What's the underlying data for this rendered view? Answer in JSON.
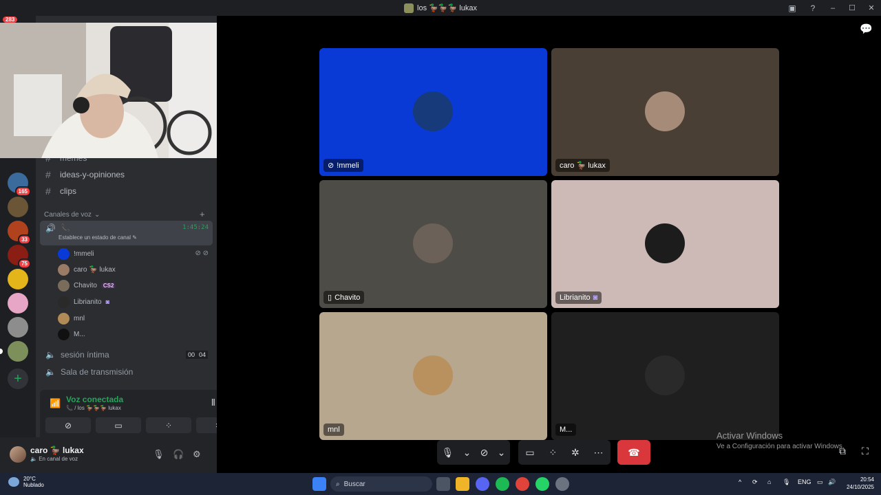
{
  "window": {
    "title": "los 🦆🦆🦆 lukax",
    "icons": [
      "inbox-icon",
      "help-icon",
      "minimize-icon",
      "maximize-icon",
      "close-icon"
    ]
  },
  "server_rail": {
    "top_badge": "283",
    "badges": [
      "165",
      "33",
      "75"
    ]
  },
  "channels": {
    "text": [
      "memes",
      "ideas-y-opiniones",
      "clips"
    ],
    "voice_category": "Canales de voz",
    "active_voice": {
      "time": "1:45:24",
      "status_placeholder": "Establece un estado de canal"
    },
    "members": [
      {
        "name": "!mmeli",
        "tag": ""
      },
      {
        "name": "caro 🦆 lukax",
        "tag": ""
      },
      {
        "name": "Chavito",
        "tag": "CS2"
      },
      {
        "name": "Librianito",
        "tag": ""
      },
      {
        "name": "mnl",
        "tag": ""
      },
      {
        "name": "M...",
        "tag": ""
      }
    ],
    "other_voice": [
      {
        "name": "sesión íntima",
        "count_a": "00",
        "count_b": "04"
      },
      {
        "name": "Sala de transmisión"
      }
    ]
  },
  "voice_panel": {
    "title": "Voz conectada",
    "subtitle": "/ los 🦆🦆🦆 lukax"
  },
  "user_panel": {
    "name": "caro 🦆 lukax",
    "status": "En canal de voz"
  },
  "tiles": [
    {
      "name": "!mmeli",
      "bg": "#0a3ad6"
    },
    {
      "name": "caro 🦆 lukax",
      "bg": "#4a3f35"
    },
    {
      "name": "Chavito",
      "bg": "#4e4c47"
    },
    {
      "name": "Librianito",
      "bg": "#cdb9b5"
    },
    {
      "name": "mnl",
      "bg": "#b7a78f"
    },
    {
      "name": "M...",
      "bg": "#1f1f1f"
    }
  ],
  "watermark": {
    "title": "Activar Windows",
    "subtitle": "Ve a Configuración para activar Windows."
  },
  "taskbar": {
    "weather_temp": "20°C",
    "weather_desc": "Nublado",
    "search_placeholder": "Buscar",
    "lang": "ENG",
    "time": "20:54",
    "date": "24/10/2025"
  },
  "colors": {
    "accent_green": "#23a55a",
    "danger_red": "#da373c",
    "sidebar_bg": "#2b2d31"
  }
}
